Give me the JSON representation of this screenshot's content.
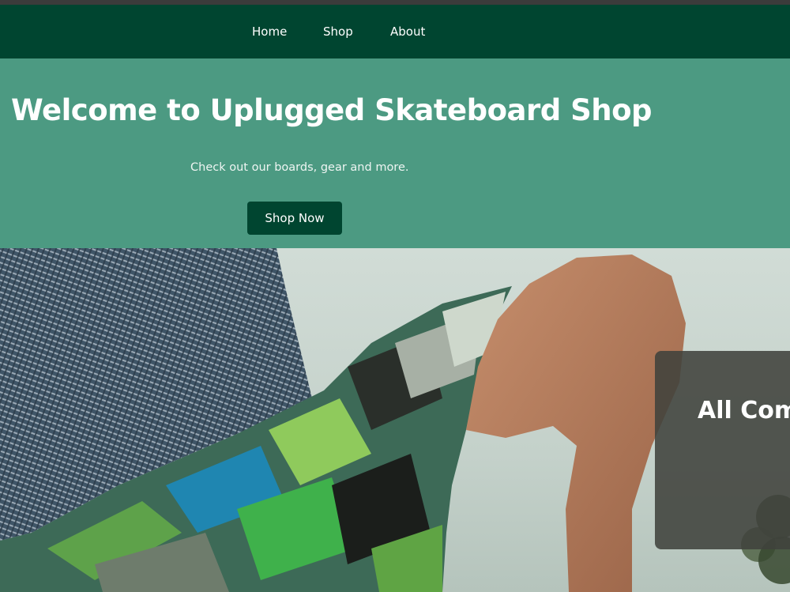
{
  "nav": {
    "items": [
      {
        "label": "Home"
      },
      {
        "label": "Shop"
      },
      {
        "label": "About"
      }
    ]
  },
  "hero": {
    "title": "Welcome to Uplugged Skateboard Shop",
    "subtitle": "Check out our boards, gear and more.",
    "cta_label": "Shop Now"
  },
  "overlay": {
    "title": "All Comp"
  },
  "colors": {
    "nav_bg": "#004530",
    "hero_bg": "#4c9a82",
    "button_bg": "#004530",
    "overlay_bg": "#40423c"
  }
}
